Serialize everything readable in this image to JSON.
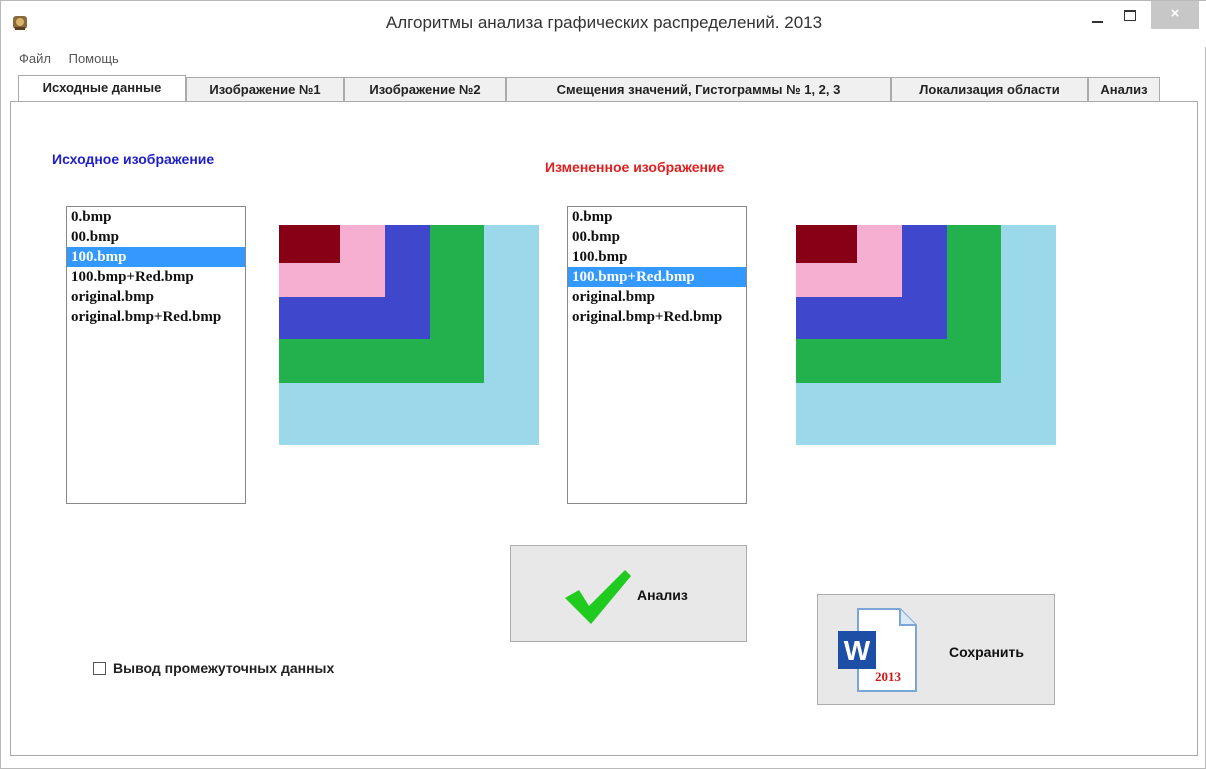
{
  "window": {
    "title": "Алгоритмы анализа графических распределений.   2013",
    "close_label": "×"
  },
  "menu": [
    "Файл",
    "Помощь"
  ],
  "tabs": [
    "Исходные данные",
    "Изображение №1",
    "Изображение №2",
    "Смещения значений, Гистограммы № 1, 2, 3",
    "Локализация области",
    "Анализ"
  ],
  "active_tab": "Исходные данные",
  "source": {
    "caption": "Исходное изображение",
    "files": [
      "0.bmp",
      "00.bmp",
      "100.bmp",
      "100.bmp+Red.bmp",
      "original.bmp",
      "original.bmp+Red.bmp"
    ],
    "selected": "100.bmp"
  },
  "modified": {
    "caption": "Измененное изображение",
    "files": [
      "0.bmp",
      "00.bmp",
      "100.bmp",
      "100.bmp+Red.bmp",
      "original.bmp",
      "original.bmp+Red.bmp"
    ],
    "selected": "100.bmp+Red.bmp"
  },
  "image_colors": {
    "background": "#9ad8ea",
    "green": "#23b14d",
    "blue": "#3f48cc",
    "pink": "#f6aed1",
    "dark_red": "#880015"
  },
  "buttons": {
    "analyze": "Анализ",
    "save": "Сохранить",
    "save_icon_letter": "W",
    "save_icon_year": "2013"
  },
  "checkbox": {
    "label": "Вывод промежуточных данных",
    "checked": false
  }
}
